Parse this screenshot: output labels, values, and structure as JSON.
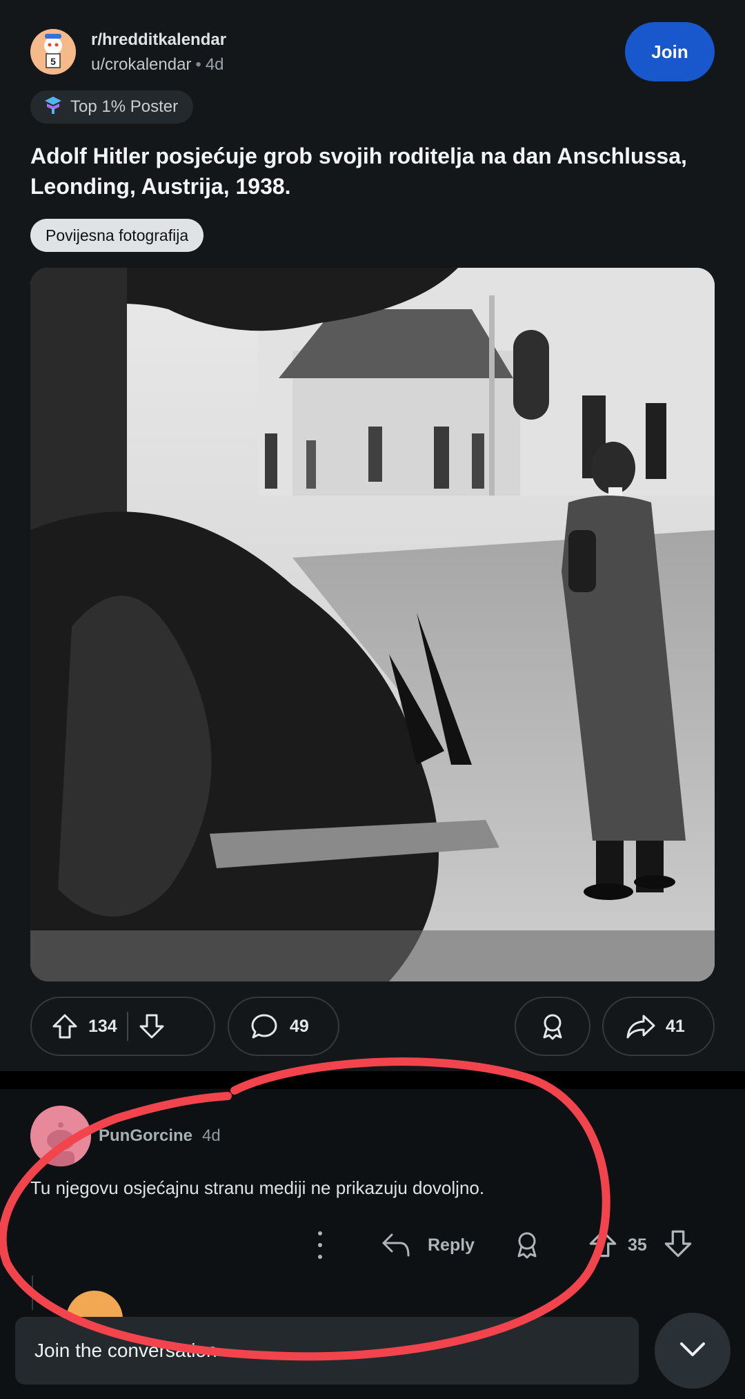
{
  "header": {
    "subreddit": "r/hredditkalendar",
    "author": "u/crokalendar",
    "separator": "•",
    "age": "4d",
    "join_label": "Join",
    "avatar_badge": "5"
  },
  "flair": {
    "icon": "top-poster-icon",
    "label": "Top 1% Poster"
  },
  "post": {
    "title": "Adolf Hitler posjećuje grob svojih roditelja na dan Anschlussa, Leonding, Austrija, 1938.",
    "tag": "Povijesna fotografija"
  },
  "actions": {
    "upvotes": "134",
    "comments": "49",
    "shares": "41"
  },
  "comment": {
    "username": "PunGorcine",
    "age": "4d",
    "body": "Tu njegovu osjećajnu stranu mediji ne prikazuju dovoljno.",
    "reply_label": "Reply",
    "score": "35"
  },
  "composer": {
    "placeholder": "Join the conversation"
  },
  "annotation": {
    "color": "#f2444d"
  }
}
